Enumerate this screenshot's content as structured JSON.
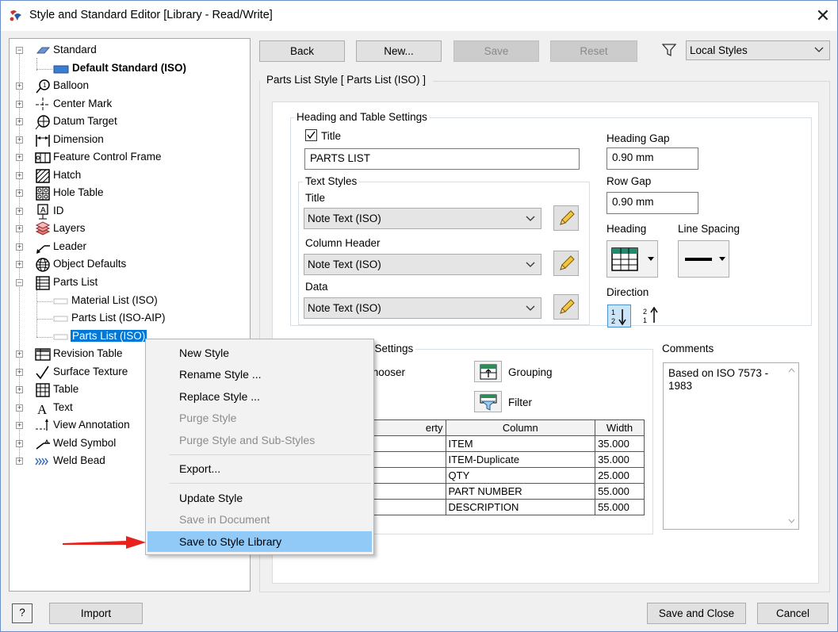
{
  "window": {
    "title": "Style and Standard Editor [Library - Read/Write]"
  },
  "toolbar": {
    "back": "Back",
    "new": "New...",
    "save": "Save",
    "reset": "Reset",
    "filter_value": "Local Styles"
  },
  "tree": {
    "standard": "Standard",
    "default_standard": "Default Standard (ISO)",
    "items": [
      "Balloon",
      "Center Mark",
      "Datum Target",
      "Dimension",
      "Feature Control Frame",
      "Hatch",
      "Hole Table",
      "ID",
      "Layers",
      "Leader",
      "Object Defaults",
      "Parts List"
    ],
    "parts_list_children": [
      "Material List (ISO)",
      "Parts List (ISO-AIP)",
      "Parts List (ISO)"
    ],
    "items_after": [
      "Revision Table",
      "Surface Texture",
      "Table",
      "Text",
      "View Annotation",
      "Weld Symbol",
      "Weld Bead"
    ]
  },
  "panel": {
    "header": "Parts List Style [ Parts List (ISO) ]",
    "heading_group": "Heading and Table Settings",
    "title_checkbox": "Title",
    "title_value": "PARTS LIST",
    "text_styles_group": "Text Styles",
    "ts_title_label": "Title",
    "ts_title_value": "Note Text (ISO)",
    "ts_column_header_label": "Column Header",
    "ts_column_header_value": "Note Text (ISO)",
    "ts_data_label": "Data",
    "ts_data_value": "Note Text (ISO)",
    "heading_gap_label": "Heading Gap",
    "heading_gap_value": "0.90 mm",
    "row_gap_label": "Row Gap",
    "row_gap_value": "0.90 mm",
    "heading_label": "Heading",
    "line_spacing_label": "Line Spacing",
    "direction_label": "Direction",
    "default_settings_group_partial": "s Settings",
    "chooser_partial": "Chooser",
    "grouping": "Grouping",
    "filter": "Filter",
    "comments_label": "Comments",
    "comments_text": "Based on ISO 7573 - 1983"
  },
  "columns_table": {
    "headers": [
      "erty",
      "Column",
      "Width"
    ],
    "rows": [
      [
        "",
        "ITEM",
        "35.000"
      ],
      [
        "",
        "ITEM-Duplicate",
        "35.000"
      ],
      [
        "",
        "QTY",
        "25.000"
      ],
      [
        "",
        "PART NUMBER",
        "55.000"
      ],
      [
        "",
        "DESCRIPTION",
        "55.000"
      ]
    ]
  },
  "context_menu": {
    "items": [
      {
        "label": "New Style",
        "enabled": true
      },
      {
        "label": "Rename Style ...",
        "enabled": true
      },
      {
        "label": "Replace Style ...",
        "enabled": true
      },
      {
        "label": "Purge Style",
        "enabled": false
      },
      {
        "label": "Purge Style and Sub-Styles",
        "enabled": false
      },
      {
        "label": "Export...",
        "enabled": true
      },
      {
        "label": "Update Style",
        "enabled": true
      },
      {
        "label": "Save in Document",
        "enabled": false
      },
      {
        "label": "Save to Style Library",
        "enabled": true,
        "highlighted": true
      }
    ]
  },
  "footer": {
    "help": "?",
    "import": "Import",
    "save_close": "Save and Close",
    "cancel": "Cancel"
  },
  "colors": {
    "selection": "#0078d7",
    "menu_highlight": "#91c9f7",
    "annotation_arrow": "#e8211c"
  }
}
